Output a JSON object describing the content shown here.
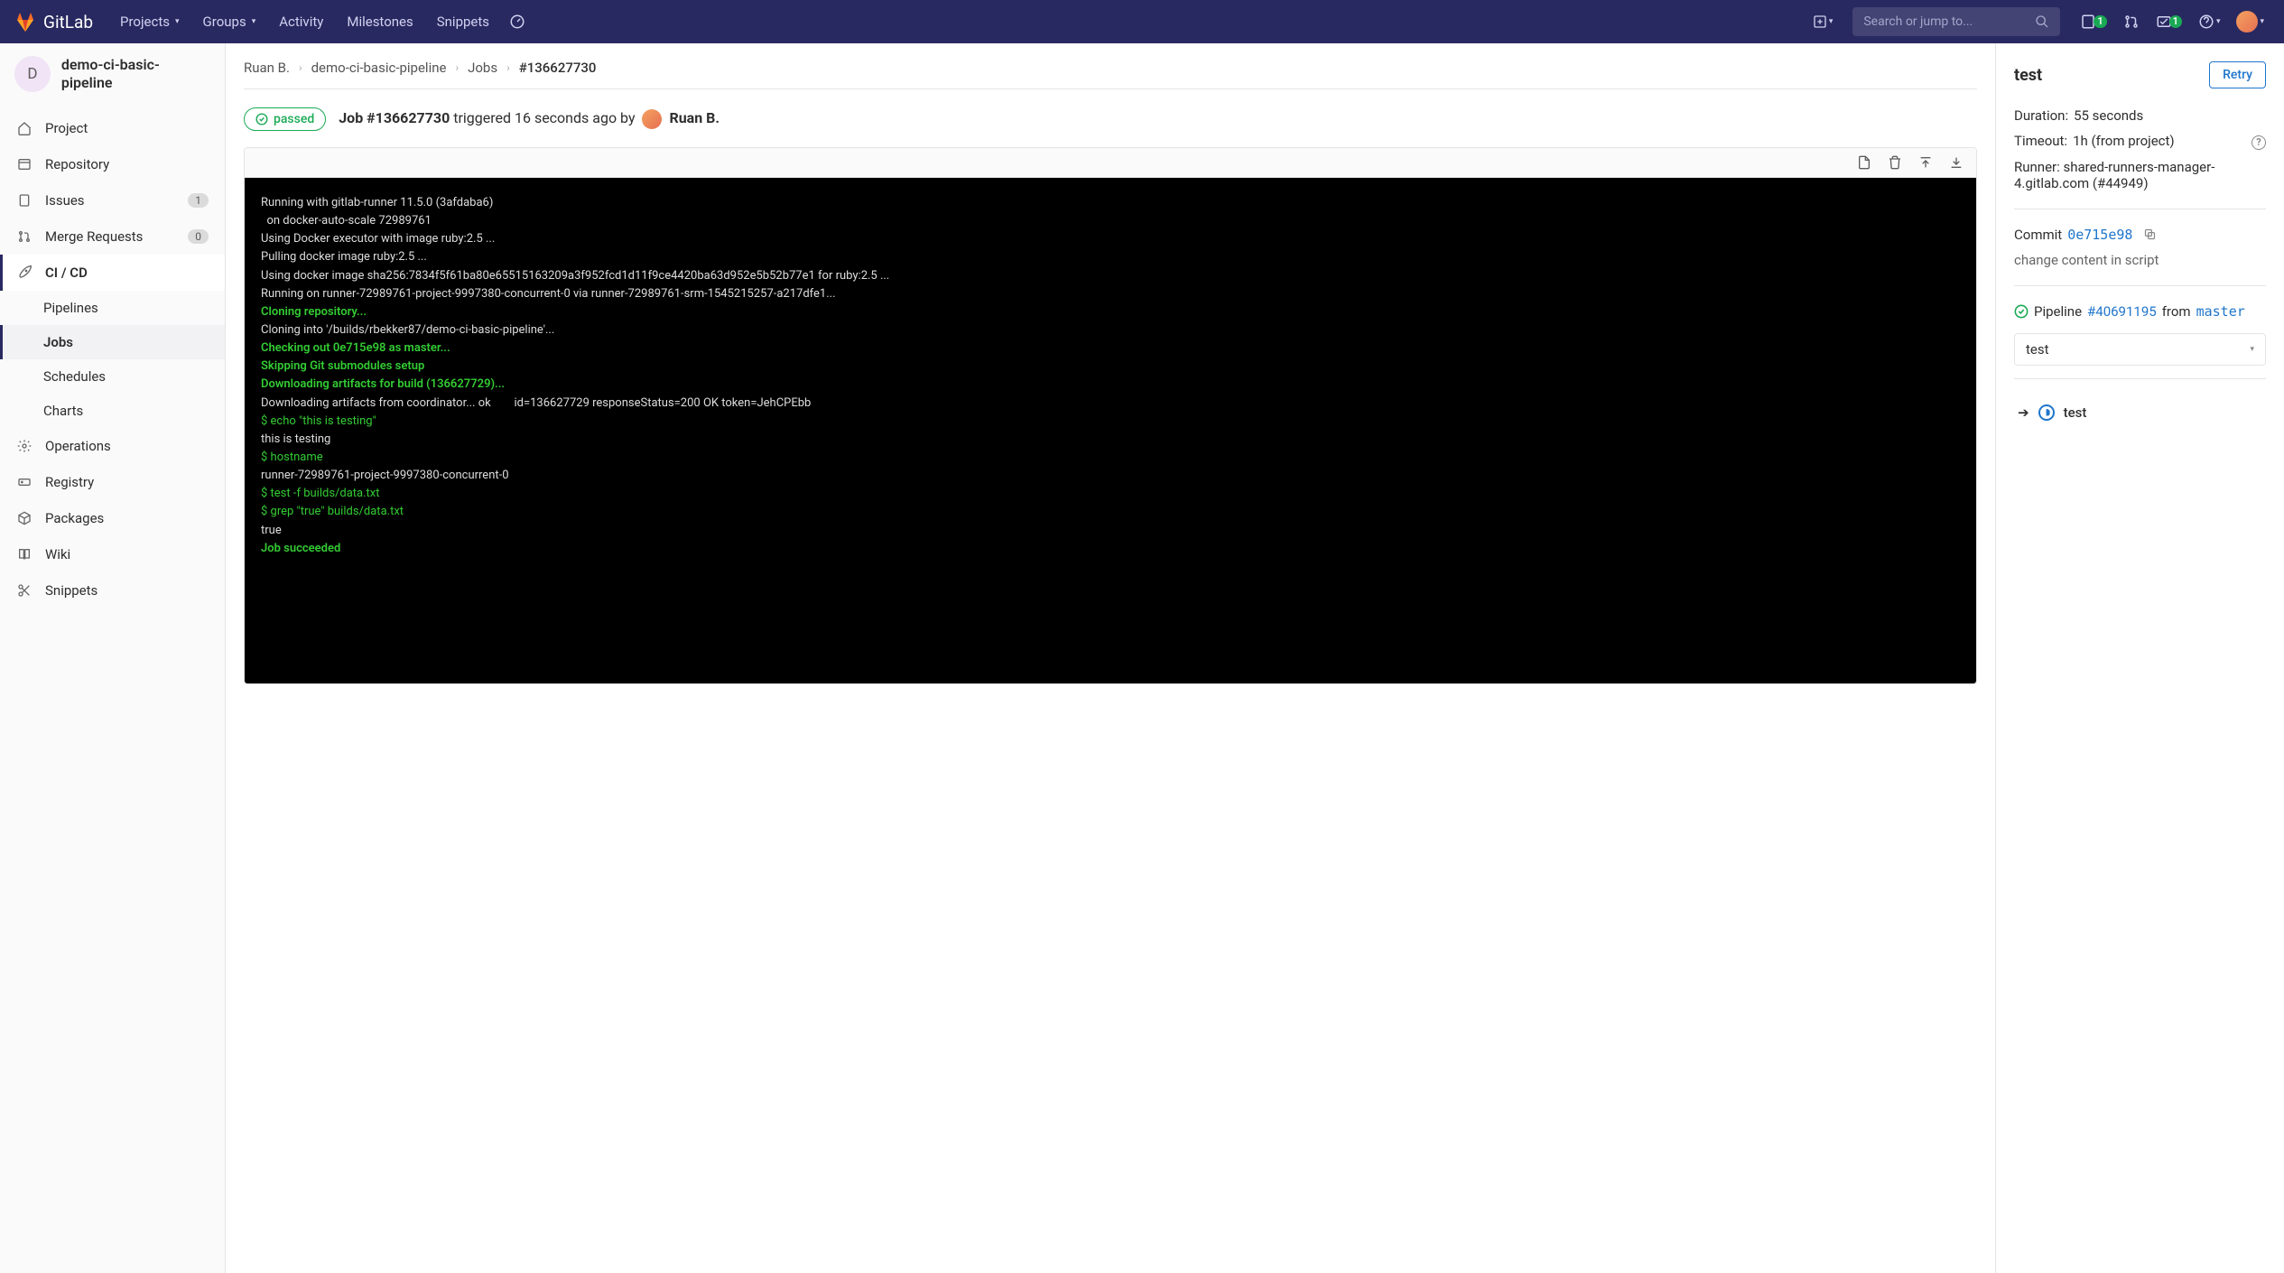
{
  "nav": {
    "brand": "GitLab",
    "items": [
      "Projects",
      "Groups",
      "Activity",
      "Milestones",
      "Snippets"
    ],
    "search_placeholder": "Search or jump to...",
    "todos_count": "1",
    "issues_count": "1"
  },
  "project": {
    "avatar_letter": "D",
    "name": "demo-ci-basic-pipeline"
  },
  "sidebar": {
    "project": "Project",
    "repository": "Repository",
    "issues": "Issues",
    "issues_count": "1",
    "merge_requests": "Merge Requests",
    "mr_count": "0",
    "cicd": "CI / CD",
    "pipelines": "Pipelines",
    "jobs": "Jobs",
    "schedules": "Schedules",
    "charts": "Charts",
    "operations": "Operations",
    "registry": "Registry",
    "packages": "Packages",
    "wiki": "Wiki",
    "snippets": "Snippets"
  },
  "breadcrumbs": {
    "user": "Ruan B.",
    "project": "demo-ci-basic-pipeline",
    "section": "Jobs",
    "job": "#136627730"
  },
  "job": {
    "status": "passed",
    "id": "Job #136627730",
    "triggered_text": " triggered 16 seconds ago by ",
    "triggered_by": "Ruan B."
  },
  "log": {
    "l1": "Running with gitlab-runner 11.5.0 (3afdaba6)",
    "l2": "  on docker-auto-scale 72989761",
    "l3": "Using Docker executor with image ruby:2.5 ...",
    "l4": "Pulling docker image ruby:2.5 ...",
    "l5": "Using docker image sha256:7834f5f61ba80e65515163209a3f952fcd1d11f9ce4420ba63d952e5b52b77e1 for ruby:2.5 ...",
    "l6": "Running on runner-72989761-project-9997380-concurrent-0 via runner-72989761-srm-1545215257-a217dfe1...",
    "g1": "Cloning repository...",
    "l7": "Cloning into '/builds/rbekker87/demo-ci-basic-pipeline'...",
    "g2": "Checking out 0e715e98 as master...",
    "g3": "Skipping Git submodules setup",
    "g4": "Downloading artifacts for build (136627729)...",
    "l8": "Downloading artifacts from coordinator... ok        id=136627729 responseStatus=200 OK token=JehCPEbb",
    "c1": "$ echo \"this is testing\"",
    "l9": "this is testing",
    "c2": "$ hostname",
    "l10": "runner-72989761-project-9997380-concurrent-0",
    "c3": "$ test -f builds/data.txt",
    "c4": "$ grep \"true\" builds/data.txt",
    "l11": "true",
    "g5": "Job succeeded"
  },
  "details": {
    "title": "test",
    "retry": "Retry",
    "duration_k": "Duration:",
    "duration_v": "55 seconds",
    "timeout_k": "Timeout:",
    "timeout_v": "1h (from project)",
    "runner_k": "Runner:",
    "runner_v": "shared-runners-manager-4.gitlab.com (#44949)",
    "commit_k": "Commit",
    "commit_sha": "0e715e98",
    "commit_msg": "change content in script",
    "pipeline_k": "Pipeline",
    "pipeline_id": "#40691195",
    "pipeline_from": "from",
    "pipeline_branch": "master",
    "stage_select": "test",
    "current_job": "test"
  }
}
